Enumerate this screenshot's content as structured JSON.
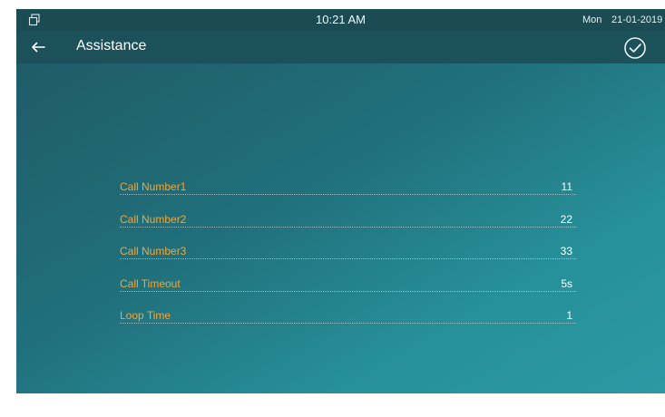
{
  "status_bar": {
    "window_icon": "window-restore-icon",
    "time": "10:21 AM",
    "day": "Mon",
    "date": "21-01-2019"
  },
  "header": {
    "back_icon": "arrow-left-icon",
    "title": "Assistance",
    "confirm_icon": "check-circle-icon"
  },
  "settings": [
    {
      "label": "Call Number1",
      "value": "11"
    },
    {
      "label": "Call Number2",
      "value": "22"
    },
    {
      "label": "Call Number3",
      "value": "33"
    },
    {
      "label": "Call Timeout",
      "value": "5s"
    },
    {
      "label": "Loop Time",
      "value": "1"
    }
  ],
  "colors": {
    "label": "#f2a53a",
    "value": "#ffffff",
    "status_bar": "#1b4b53",
    "title_bar": "#1d515a",
    "background_start": "#1f5864",
    "background_end": "#2b9aa3"
  }
}
